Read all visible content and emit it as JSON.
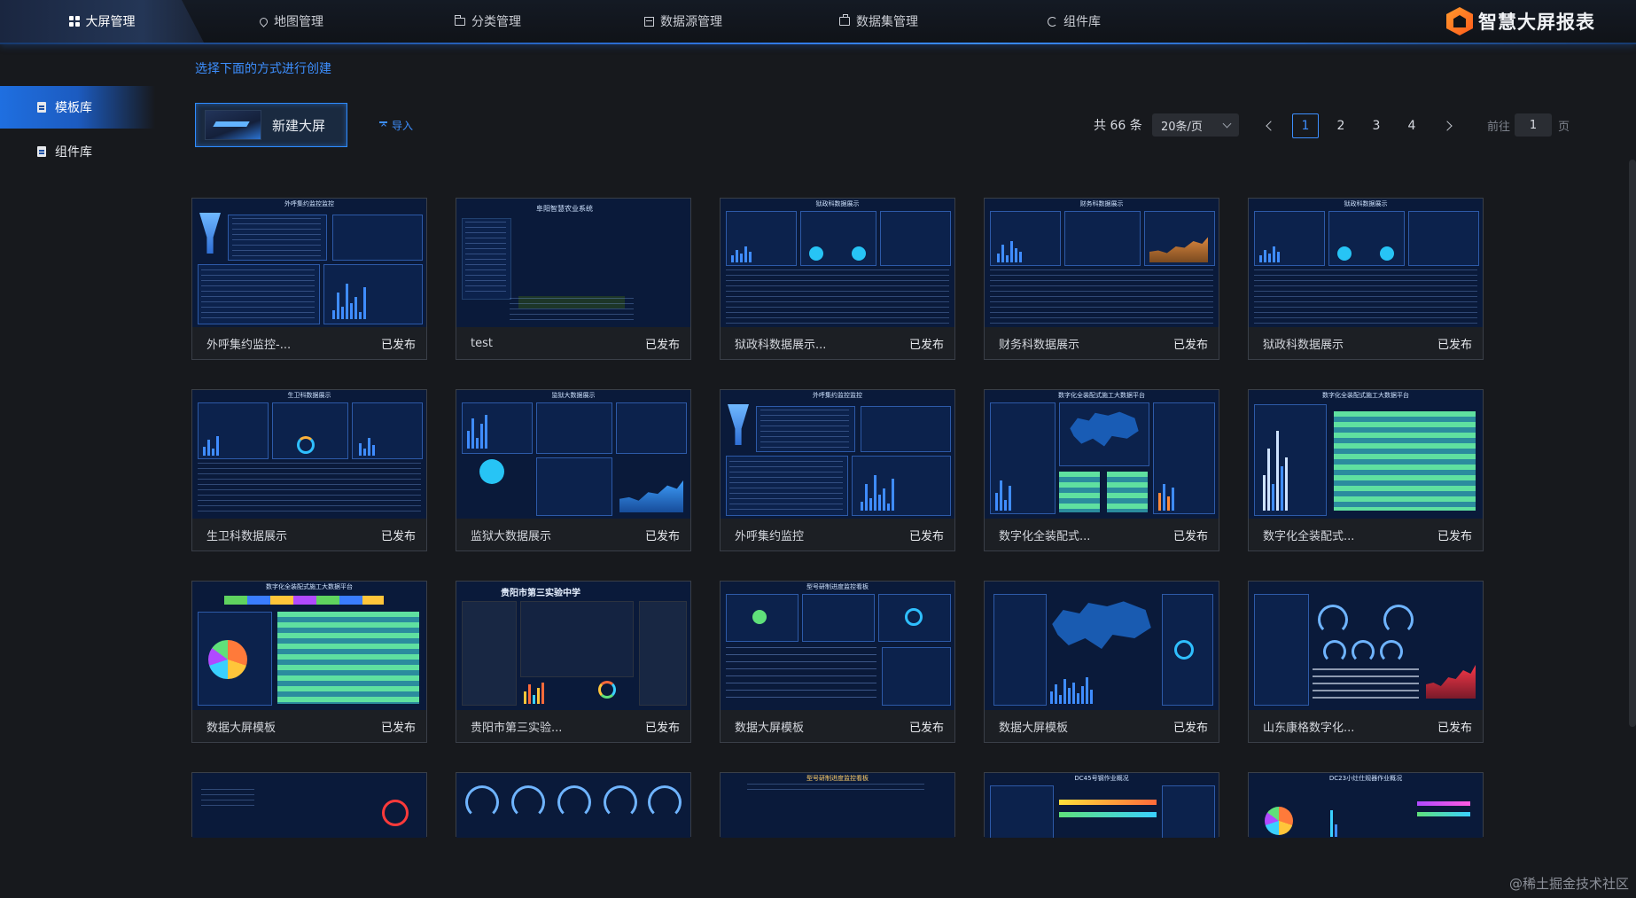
{
  "topnav": {
    "items": [
      {
        "label": "大屏管理",
        "icon": "grid-icon",
        "active": true
      },
      {
        "label": "地图管理",
        "icon": "map-pin-icon"
      },
      {
        "label": "分类管理",
        "icon": "folder-icon"
      },
      {
        "label": "数据源管理",
        "icon": "database-icon"
      },
      {
        "label": "数据集管理",
        "icon": "dataset-icon"
      },
      {
        "label": "组件库",
        "icon": "component-icon"
      }
    ],
    "brand": "智慧大屏报表"
  },
  "sidebar": {
    "items": [
      {
        "label": "模板库",
        "active": true
      },
      {
        "label": "组件库"
      }
    ]
  },
  "main": {
    "create_hint": "选择下面的方式进行创建",
    "new_button": "新建大屏",
    "import_label": "导入"
  },
  "pagination": {
    "total_text": "共 66 条",
    "page_size": "20条/页",
    "pages": [
      "1",
      "2",
      "3",
      "4"
    ],
    "current_page": "1",
    "goto_prefix": "前往",
    "goto_value": "1",
    "goto_suffix": "页"
  },
  "cards": [
    {
      "title": "外呼集约监控-...",
      "status": "已发布",
      "thumb_title": "外呼集约监控监控"
    },
    {
      "title": "test",
      "status": "已发布",
      "thumb_title": "阜阳智慧农业系统"
    },
    {
      "title": "狱政科数据展示...",
      "status": "已发布",
      "thumb_title": "狱政科数据展示"
    },
    {
      "title": "财务科数据展示",
      "status": "已发布",
      "thumb_title": "财务科数据展示"
    },
    {
      "title": "狱政科数据展示",
      "status": "已发布",
      "thumb_title": "狱政科数据展示"
    },
    {
      "title": "生卫科数据展示",
      "status": "已发布",
      "thumb_title": "生卫科数据展示"
    },
    {
      "title": "监狱大数据展示",
      "status": "已发布",
      "thumb_title": "监狱大数据展示"
    },
    {
      "title": "外呼集约监控",
      "status": "已发布",
      "thumb_title": "外呼集约监控监控"
    },
    {
      "title": "数字化全装配式...",
      "status": "已发布",
      "thumb_title": "数字化全装配式施工大数据平台"
    },
    {
      "title": "数字化全装配式...",
      "status": "已发布",
      "thumb_title": "数字化全装配式施工大数据平台"
    },
    {
      "title": "数据大屏模板",
      "status": "已发布",
      "thumb_title": "数字化全装配式施工大数据平台"
    },
    {
      "title": "贵阳市第三实验...",
      "status": "已发布",
      "thumb_title": "贵阳市第三实验中学"
    },
    {
      "title": "数据大屏模板",
      "status": "已发布",
      "thumb_title": "型号研制进度监控看板"
    },
    {
      "title": "数据大屏模板",
      "status": "已发布",
      "thumb_title": ""
    },
    {
      "title": "山东康格数字化...",
      "status": "已发布",
      "thumb_title": ""
    },
    {
      "title": "",
      "status": "",
      "thumb_title": ""
    },
    {
      "title": "",
      "status": "",
      "thumb_title": ""
    },
    {
      "title": "",
      "status": "",
      "thumb_title": "型号研制进度监控看板"
    },
    {
      "title": "",
      "status": "",
      "thumb_title": "DC45号钢作业概况"
    },
    {
      "title": "",
      "status": "",
      "thumb_title": "DC23小灶仕规器作业概况"
    }
  ],
  "watermark": "@稀土掘金技术社区",
  "colors": {
    "accent": "#3d8fff",
    "active_side": "#1f6fe0",
    "bg": "#17191d"
  }
}
